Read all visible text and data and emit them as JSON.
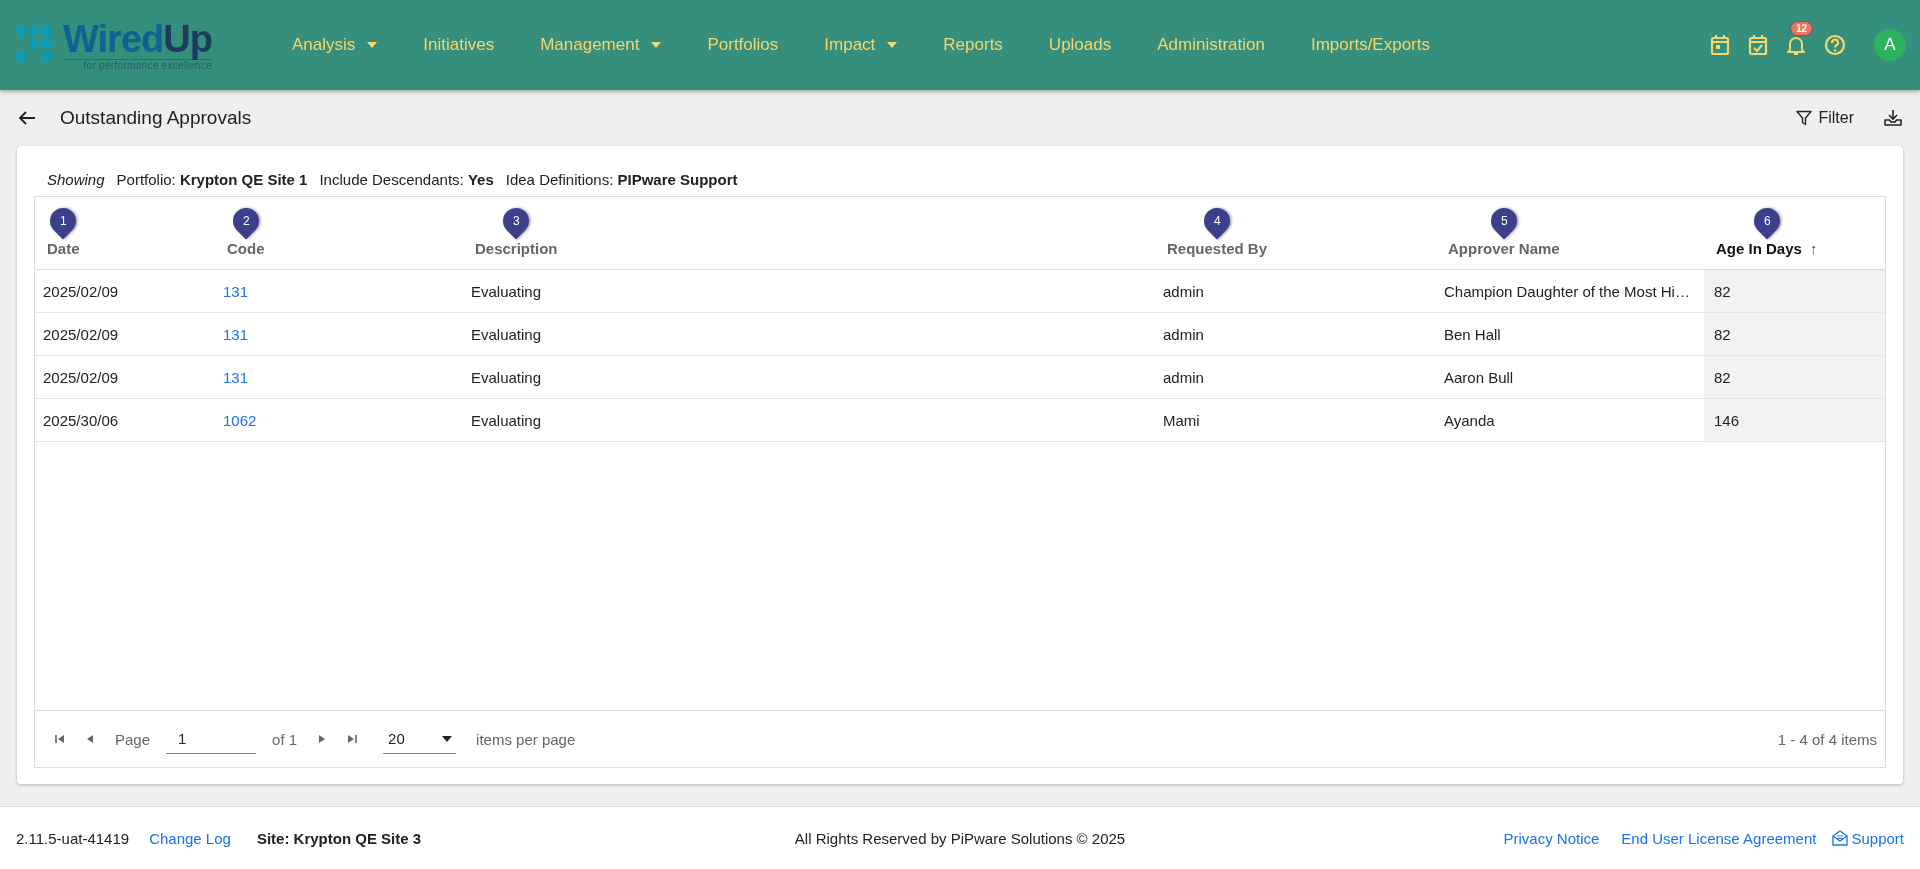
{
  "header": {
    "logo": {
      "word_1": "Wired",
      "word_2": "Up",
      "tagline": "for performance excellence"
    },
    "nav": [
      {
        "label": "Analysis",
        "dropdown": true
      },
      {
        "label": "Initiatives",
        "dropdown": false
      },
      {
        "label": "Management",
        "dropdown": true
      },
      {
        "label": "Portfolios",
        "dropdown": false
      },
      {
        "label": "Impact",
        "dropdown": true
      },
      {
        "label": "Reports",
        "dropdown": false
      },
      {
        "label": "Uploads",
        "dropdown": false
      },
      {
        "label": "Administration",
        "dropdown": false
      },
      {
        "label": "Imports/Exports",
        "dropdown": false
      }
    ],
    "notifications_badge": "12",
    "avatar": "A"
  },
  "page": {
    "title": "Outstanding Approvals",
    "filter_button": "Filter"
  },
  "showing": [
    {
      "kind": "lead",
      "text": "Showing"
    },
    {
      "kind": "pair",
      "text": "Portfolio: **Krypton QE Site 1**"
    },
    {
      "kind": "pair",
      "text": "Include Descendants: **Yes**"
    },
    {
      "kind": "pair",
      "text": "Idea Definitions: **PIPware Support**"
    }
  ],
  "table": {
    "columns": [
      {
        "label": "Date",
        "marker": "1",
        "sorted": false
      },
      {
        "label": "Code",
        "marker": "2",
        "sorted": false,
        "kind": "link"
      },
      {
        "label": "Description",
        "marker": "3",
        "sorted": false
      },
      {
        "label": "Requested By",
        "marker": "4",
        "sorted": false
      },
      {
        "label": "Approver Name",
        "marker": "5",
        "sorted": false
      },
      {
        "label": "Age In Days",
        "marker": "6",
        "sorted": true,
        "sort_arrow": "↑"
      }
    ],
    "rows": [
      [
        "2025/02/09",
        "131",
        "Evaluating",
        "admin",
        "Champion Daughter of the Most Hi…",
        "82"
      ],
      [
        "2025/02/09",
        "131",
        "Evaluating",
        "admin",
        "Ben Hall",
        "82"
      ],
      [
        "2025/02/09",
        "131",
        "Evaluating",
        "admin",
        "Aaron Bull",
        "82"
      ],
      [
        "2025/30/06",
        "1062",
        "Evaluating",
        "Mami",
        "Ayanda",
        "146"
      ]
    ]
  },
  "pager": {
    "page_label": "Page",
    "page": "1",
    "of": "of 1",
    "page_size": "20",
    "per_page_label": "items per page",
    "summary": "1 - 4 of 4 items"
  },
  "footer": {
    "version": "2.11.5-uat-41419",
    "change_log": "Change Log",
    "site": "Site: Krypton QE Site 3",
    "copyright": "All Rights Reserved by PiPware Solutions © 2025",
    "privacy": "Privacy Notice",
    "eula": "End User License Agreement",
    "support": "Support"
  }
}
